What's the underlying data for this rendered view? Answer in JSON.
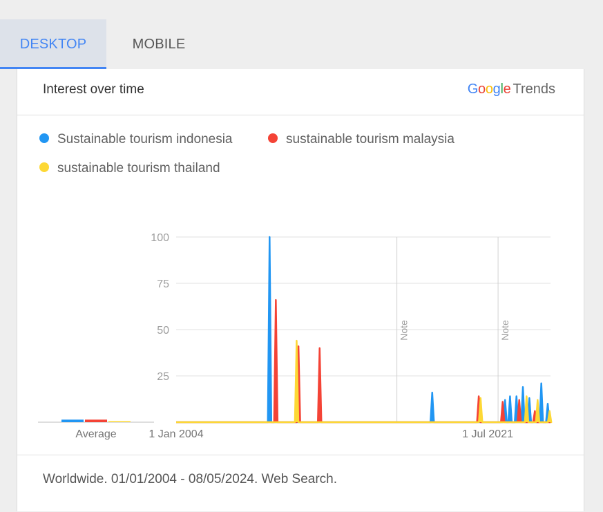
{
  "tabs": [
    {
      "label": "DESKTOP",
      "active": true
    },
    {
      "label": "MOBILE",
      "active": false
    }
  ],
  "card": {
    "title": "Interest over time",
    "brand": {
      "google": "Google",
      "product": "Trends"
    },
    "footer": "Worldwide. 01/01/2004 - 08/05/2024. Web Search."
  },
  "colors": {
    "indonesia": "#2196f3",
    "malaysia": "#f44336",
    "thailand": "#fdd835",
    "google_blue": "#4285f4",
    "google_red": "#ea4335",
    "google_yellow": "#fbbc05",
    "google_green": "#34a853"
  },
  "chart_data": {
    "type": "line",
    "ylim": [
      0,
      100
    ],
    "yticks": [
      "100",
      "75",
      "50",
      "25"
    ],
    "xtick_labels": [
      "1 Jan 2004",
      "1 Jul 2021"
    ],
    "xlim_years": [
      2004.0,
      2024.35
    ],
    "grid": true,
    "legend_position": "top-left",
    "notes": [
      {
        "label": "Note",
        "year": 2016.0
      },
      {
        "label": "Note",
        "year": 2021.5
      }
    ],
    "averages": {
      "label": "Average",
      "values": {
        "indonesia": 1,
        "malaysia": 1,
        "thailand": 0
      }
    },
    "series": [
      {
        "name": "Sustainable tourism indonesia",
        "key": "indonesia",
        "points": [
          [
            2009.08,
            100
          ],
          [
            2017.92,
            16
          ],
          [
            2021.88,
            12
          ],
          [
            2022.15,
            14
          ],
          [
            2022.5,
            14
          ],
          [
            2022.85,
            19
          ],
          [
            2023.2,
            13
          ],
          [
            2023.85,
            21
          ],
          [
            2024.2,
            10
          ]
        ]
      },
      {
        "name": "sustainable tourism malaysia",
        "key": "malaysia",
        "points": [
          [
            2009.42,
            66
          ],
          [
            2010.65,
            41
          ],
          [
            2011.8,
            40
          ],
          [
            2020.45,
            14
          ],
          [
            2021.75,
            11
          ],
          [
            2022.65,
            12
          ],
          [
            2023.5,
            6
          ]
        ]
      },
      {
        "name": "sustainable tourism thailand",
        "key": "thailand",
        "points": [
          [
            2010.55,
            44
          ],
          [
            2020.55,
            13
          ],
          [
            2023.05,
            14
          ],
          [
            2023.65,
            12
          ],
          [
            2024.3,
            6
          ]
        ]
      }
    ]
  }
}
